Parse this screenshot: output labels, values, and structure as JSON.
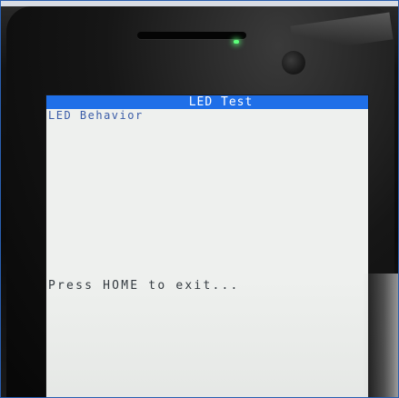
{
  "screen": {
    "title": "LED Test",
    "subtitle": "LED Behavior",
    "message": "Press HOME to exit..."
  },
  "colors": {
    "title_bar": "#1f6fe8",
    "screen_background": "#eef0ee",
    "subtitle_text": "#3a5ca8",
    "led_indicator": "#5cff7a"
  },
  "icons": {
    "led": "led-indicator-icon",
    "camera": "front-camera-icon",
    "speaker": "earpiece-speaker-icon"
  }
}
